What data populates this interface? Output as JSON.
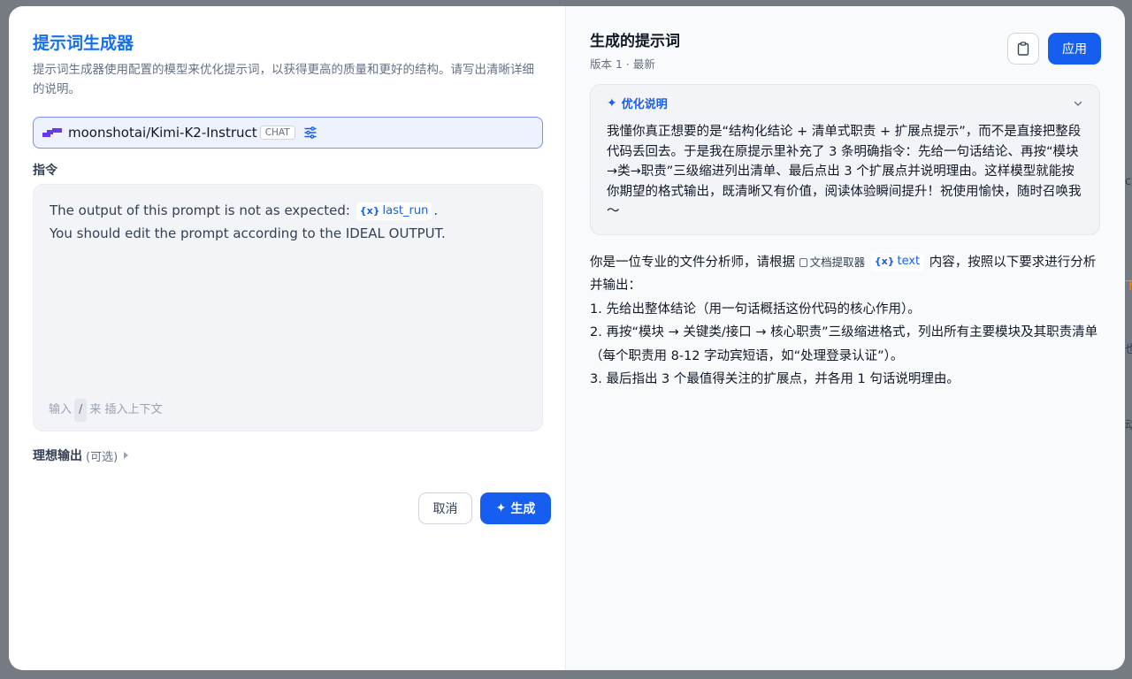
{
  "left": {
    "title": "提示词生成器",
    "description": "提示词生成器使用配置的模型来优化提示词，以获得更高的质量和更好的结构。请写出清晰详细的说明。",
    "model": {
      "name": "moonshotai/Kimi-K2-Instruct",
      "badge": "CHAT",
      "logo_color": "#6938ef",
      "settings_icon": "sliders-icon"
    },
    "instruction_label": "指令",
    "instruction": {
      "line1_prefix": "The output of this prompt is not as expected:",
      "var_chip_icon": "{x}",
      "var_chip_name": "last_run",
      "line1_suffix": ".",
      "line2": "You should edit the prompt according to the IDEAL OUTPUT."
    },
    "hint": {
      "before": "输入",
      "key": "/",
      "after": "来 插入上下文"
    },
    "ideal_output": {
      "label": "理想输出",
      "optional": "(可选)"
    },
    "buttons": {
      "cancel": "取消",
      "generate": "生成"
    }
  },
  "right": {
    "title": "生成的提示词",
    "version": "版本 1 · 最新",
    "apply": "应用",
    "copy_icon": "clipboard-icon",
    "optimization": {
      "label": "优化说明",
      "icon": "sparkle-icon",
      "body": "我懂你真正想要的是“结构化结论 + 清单式职责 + 扩展点提示”，而不是直接把整段代码丢回去。于是我在原提示里补充了 3 条明确指令：先给一句话结论、再按“模块→类→职责”三级缩进列出清单、最后点出 3 个扩展点并说明理由。这样模型就能按你期望的格式输出，既清晰又有价值，阅读体验瞬间提升！祝使用愉快，随时召唤我～"
    },
    "result": {
      "intro_before": "你是一位专业的文件分析师，请根据",
      "doc_chip": "文档提取器",
      "var_chip_icon": "{x}",
      "var_chip_name": "text",
      "intro_after": "内容，按照以下要求进行分析并输出：",
      "items": [
        "1. 先给出整体结论（用一句话概括这份代码的核心作用）。",
        "2. 再按“模块 → 关键类/接口 → 核心职责”三级缩进格式，列出所有主要模块及其职责清单（每个职责用 8-12 字动宾短语，如“处理登录认证”）。",
        "3. 最后指出 3 个最值得关注的扩展点，并各用 1 句话说明理由。"
      ]
    }
  },
  "colors": {
    "accent": "#155eef",
    "title_blue": "#1570ef"
  }
}
